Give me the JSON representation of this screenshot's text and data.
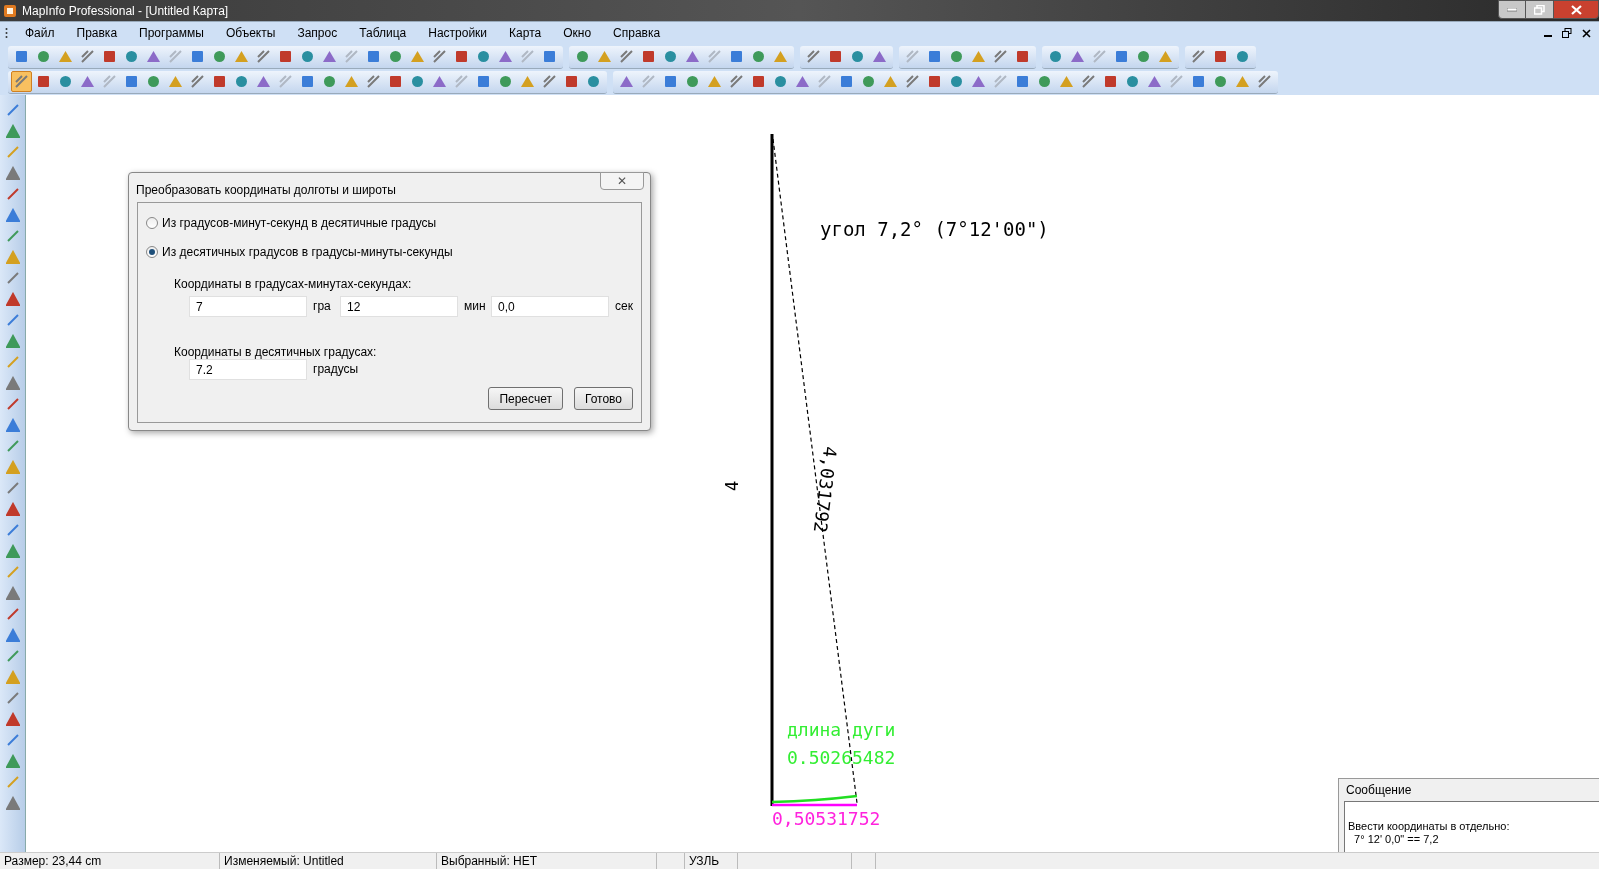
{
  "window": {
    "title": "MapInfo Professional - [Untitled Карта]"
  },
  "menu": [
    "Файл",
    "Правка",
    "Программы",
    "Объекты",
    "Запрос",
    "Таблица",
    "Настройки",
    "Карта",
    "Окно",
    "Справка"
  ],
  "select_tool": {
    "selected": true
  },
  "map": {
    "angle_label": "угол 7,2° (7°12'00\")",
    "side_label": "4",
    "hypotenuse_label": "4,031792",
    "arc_caption": "длина дуги",
    "arc_value": "0.50265482",
    "chord_value": "0,50531752"
  },
  "dialog": {
    "title": "Преобразовать координаты долготы и широты",
    "close": "✕",
    "options": [
      {
        "label": "Из градусов-минут-секунд в десятичные градусы",
        "selected": false
      },
      {
        "label": "Из десятичных градусов в градусы-минуты-секунды",
        "selected": true
      }
    ],
    "dms_label": "Координаты в градусах-минутах-секундах:",
    "dms_fields": [
      {
        "value": "7",
        "unit": "гра"
      },
      {
        "value": "12",
        "unit": "мин"
      },
      {
        "value": "0,0",
        "unit": "сек"
      }
    ],
    "decimal_label": "Координаты в десятичных градусах:",
    "decimal_field": {
      "value": "7.2",
      "unit": "градусы"
    },
    "buttons": [
      "Пересчет",
      "Готово"
    ]
  },
  "message_window": {
    "title": "Сообщение",
    "lines": [
      "Ввести координаты в отдельно:",
      "  7° 12' 0,0\" == 7,2"
    ]
  },
  "status_bar": [
    "Размер: 23,44 cm",
    "Изменяемый: Untitled",
    "Выбранный: НЕТ",
    "УЗЛЬ"
  ]
}
